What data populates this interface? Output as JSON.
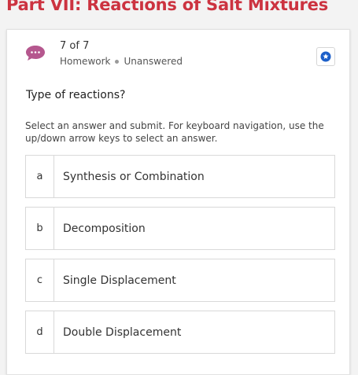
{
  "page": {
    "title": "Part VII: Reactions of Salt Mixtures"
  },
  "question_header": {
    "position": "7 of 7",
    "category": "Homework",
    "status": "Unanswered",
    "avatar_icon": "chat-bubble-icon",
    "avatar_color": "#b5578e",
    "flag_icon": "star-badge-icon",
    "flag_color": "#1c5fc9"
  },
  "question": {
    "prompt": "Type of reactions?",
    "instructions": "Select an answer and submit. For keyboard navigation, use the up/down arrow keys to select an answer.",
    "options": [
      {
        "letter": "a",
        "label": "Synthesis or Combination"
      },
      {
        "letter": "b",
        "label": "Decomposition"
      },
      {
        "letter": "c",
        "label": "Single Displacement"
      },
      {
        "letter": "d",
        "label": "Double Displacement"
      }
    ]
  },
  "colors": {
    "title": "#cc3340",
    "background": "#f3f3f3"
  }
}
